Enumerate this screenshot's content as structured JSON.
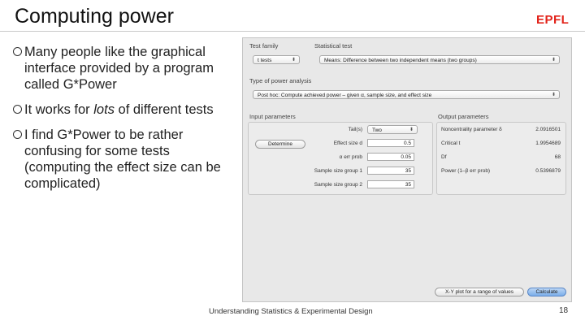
{
  "slide": {
    "title": "Computing power",
    "logo": "EPFL",
    "footer": "Understanding Statistics & Experimental Design",
    "page": "18"
  },
  "bullets": [
    {
      "text": "Many people like the graphical interface provided by a program called G*Power"
    },
    {
      "pre": "It works for ",
      "em": "lots",
      "post": " of different tests"
    },
    {
      "text": "I find G*Power to be rather confusing for some tests (computing the effect size can be complicated)"
    }
  ],
  "gpower": {
    "test_family_label": "Test family",
    "test_family_value": "t tests",
    "statistical_test_label": "Statistical test",
    "statistical_test_value": "Means: Difference between two independent means (two groups)",
    "analysis_type_label": "Type of power analysis",
    "analysis_type_value": "Post hoc: Compute achieved power – given α, sample size, and effect size",
    "input_label": "Input parameters",
    "output_label": "Output parameters",
    "determine_button": "Determine",
    "inputs": [
      {
        "label": "Tail(s)",
        "value": "Two"
      },
      {
        "label": "Effect size d",
        "value": "0.5"
      },
      {
        "label": "α err prob",
        "value": "0.05"
      },
      {
        "label": "Sample size group 1",
        "value": "35"
      },
      {
        "label": "Sample size group 2",
        "value": "35"
      }
    ],
    "outputs": [
      {
        "label": "Noncentrality parameter δ",
        "value": "2.0916501"
      },
      {
        "label": "Critical t",
        "value": "1.9954689"
      },
      {
        "label": "Df",
        "value": "68"
      },
      {
        "label": "Power (1–β err prob)",
        "value": "0.5396879"
      }
    ],
    "xy_plot_button": "X-Y plot for a range of values",
    "calculate_button": "Calculate"
  }
}
